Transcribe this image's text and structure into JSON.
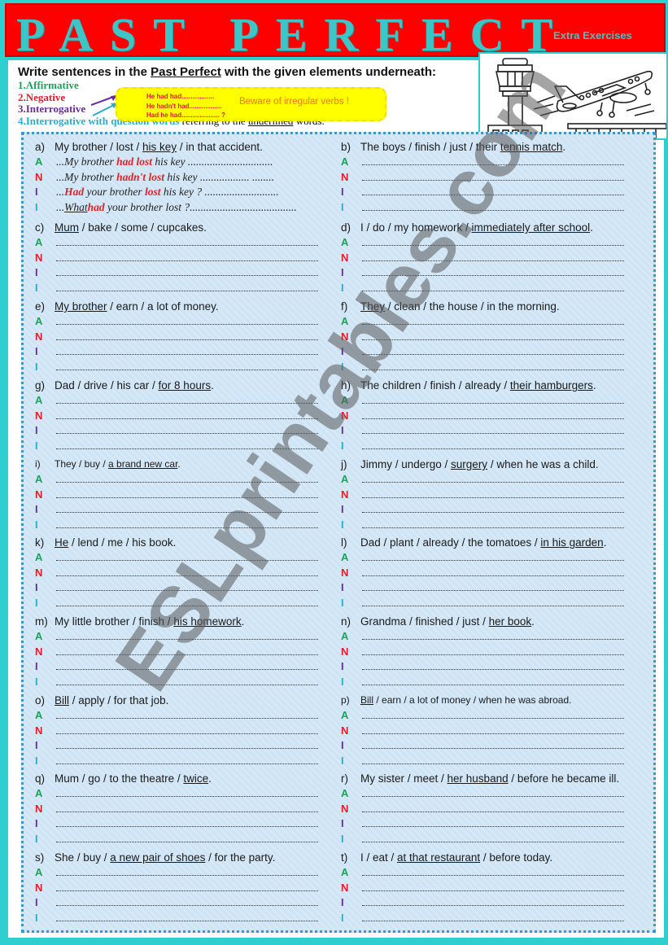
{
  "header": {
    "title": "PAST PERFECT",
    "subtitle": "Extra Exercises"
  },
  "instructions": {
    "heading_pre": "Write sentences in the ",
    "heading_underlined": "Past Perfect",
    "heading_post": " with the given elements underneath:",
    "items": [
      {
        "label": "1.Affirmative"
      },
      {
        "label": "2.Negative"
      },
      {
        "label": "3.Interrogative"
      },
      {
        "label": "4.Interrogative with question words",
        "rest_pre": " referring to the ",
        "rest_underlined": "underlined",
        "rest_post": " words."
      }
    ],
    "hint_box": {
      "lines": [
        "He had had..................",
        "He hadn't had..................",
        "Had he had..................... ?"
      ],
      "warning": "Beware of irregular verbs !"
    }
  },
  "answer_labels": [
    "A",
    "N",
    "I",
    "I"
  ],
  "example": {
    "answers": [
      {
        "pre": "...My brother ",
        "hl": "had lost",
        "post": " his key ..............................."
      },
      {
        "pre": "...My brother ",
        "hl": "hadn't lost",
        "post": " his key  ..................  ........"
      },
      {
        "pre": "...",
        "hl": "Had",
        "mid": " your brother ",
        "hl2": "lost",
        "post": " his key ? ..........................."
      },
      {
        "pre": "...",
        "u": "What",
        "hl": "had",
        "post": " your brother lost ?......................................."
      }
    ]
  },
  "exercises": [
    {
      "letter": "a)",
      "parts": [
        {
          "t": "My brother / lost / "
        },
        {
          "u": "his key"
        },
        {
          "t": " / in that accident."
        }
      ]
    },
    {
      "letter": "b)",
      "parts": [
        {
          "t": "The boys / finish / just / their "
        },
        {
          "u": "tennis match"
        },
        {
          "t": "."
        }
      ]
    },
    {
      "letter": "c)",
      "parts": [
        {
          "u": "Mum"
        },
        {
          "t": " / bake / some / cupcakes."
        }
      ]
    },
    {
      "letter": "d)",
      "parts": [
        {
          "t": "I / do / my homework / "
        },
        {
          "u": "immediately after school"
        },
        {
          "t": "."
        }
      ]
    },
    {
      "letter": "e)",
      "parts": [
        {
          "u": "My brother"
        },
        {
          "t": " / earn / a lot of money."
        }
      ]
    },
    {
      "letter": "f)",
      "parts": [
        {
          "u": "They"
        },
        {
          "t": " / clean / the house / in the morning."
        }
      ]
    },
    {
      "letter": "g)",
      "parts": [
        {
          "t": "Dad / drive / his car / "
        },
        {
          "u": "for 8 hours"
        },
        {
          "t": "."
        }
      ]
    },
    {
      "letter": "h)",
      "parts": [
        {
          "t": "The children / finish / already /  "
        },
        {
          "u": "their hamburgers"
        },
        {
          "t": "."
        }
      ]
    },
    {
      "letter": "i)",
      "parts": [
        {
          "t": "They / buy / "
        },
        {
          "u": "a brand new car"
        },
        {
          "t": "."
        }
      ],
      "small": true
    },
    {
      "letter": "j)",
      "parts": [
        {
          "t": "Jimmy / undergo / "
        },
        {
          "u": "surgery"
        },
        {
          "t": " / when he was a child."
        }
      ]
    },
    {
      "letter": "k)",
      "parts": [
        {
          "u": "He"
        },
        {
          "t": " / lend / me / his book."
        }
      ]
    },
    {
      "letter": "l)",
      "parts": [
        {
          "t": "Dad / plant / already / the tomatoes / "
        },
        {
          "u": "in his garden"
        },
        {
          "t": "."
        }
      ]
    },
    {
      "letter": "m)",
      "parts": [
        {
          "t": "My little brother / finish / "
        },
        {
          "u": "his homework"
        },
        {
          "t": "."
        }
      ]
    },
    {
      "letter": "n)",
      "parts": [
        {
          "t": "Grandma / finished / just / "
        },
        {
          "u": "her book"
        },
        {
          "t": "."
        }
      ]
    },
    {
      "letter": "o)",
      "parts": [
        {
          "u": "Bill"
        },
        {
          "t": " / apply / for that job."
        }
      ]
    },
    {
      "letter": "p)",
      "parts": [
        {
          "u": "Bill"
        },
        {
          "t": " / earn / a lot of money / when he was abroad."
        }
      ],
      "small": true
    },
    {
      "letter": "q)",
      "parts": [
        {
          "t": "Mum / go / to the theatre / "
        },
        {
          "u": "twice"
        },
        {
          "t": "."
        }
      ]
    },
    {
      "letter": "r)",
      "parts": [
        {
          "t": "My sister / meet / "
        },
        {
          "u": "her husband"
        },
        {
          "t": " / before he became ill."
        }
      ]
    },
    {
      "letter": "s)",
      "parts": [
        {
          "t": "She / buy / "
        },
        {
          "u": "a new pair of shoes"
        },
        {
          "t": " /  for the party."
        }
      ]
    },
    {
      "letter": "t)",
      "parts": [
        {
          "t": "I / eat / "
        },
        {
          "u": "at that restaurant"
        },
        {
          "t": " / before today."
        }
      ]
    }
  ],
  "watermark": "ESLprintables.com",
  "colors": {
    "title_bg": "#ff0000",
    "title_text": "#3ec6c6",
    "page_border": "#2fcfcf",
    "affirmative": "#1fa05a",
    "negative": "#e0202a",
    "interrogative": "#6b2d9b",
    "question_words": "#2aaecd",
    "hint_box": "#ffff00"
  }
}
